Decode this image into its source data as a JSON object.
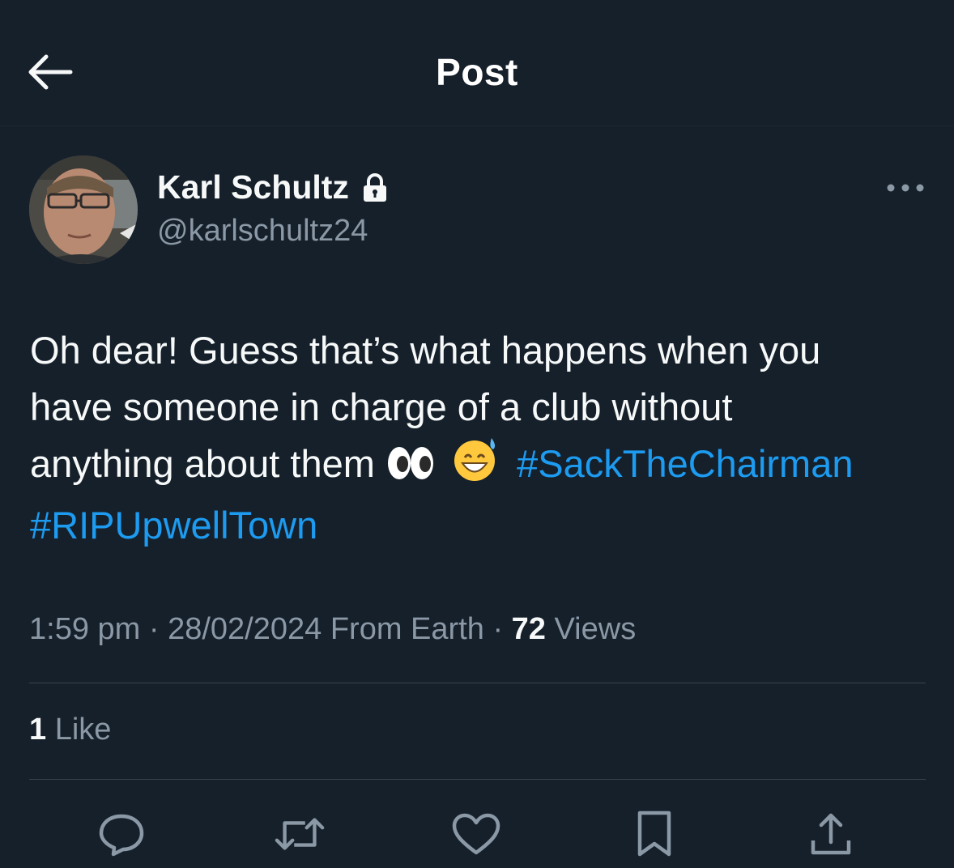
{
  "header": {
    "title": "Post",
    "back_icon": "arrow-left-icon"
  },
  "author": {
    "display_name": "Karl Schultz",
    "handle": "@karlschultz24",
    "protected_icon": "lock-icon"
  },
  "post": {
    "text_line_1": "Oh dear! Guess that’s what happens when you",
    "text_line_2": "have someone in charge of a club without",
    "text_line_3_prefix": "anything about them",
    "emojis": [
      "👀",
      "😅"
    ],
    "hashtags": [
      "#SackTheChairman",
      "#RIPUpwellTown"
    ]
  },
  "meta": {
    "time": "1:59 pm",
    "separator": "·",
    "date": "28/02/2024",
    "source": "From Earth",
    "views_count": "72",
    "views_label": "Views"
  },
  "engagement": {
    "likes_count": "1",
    "likes_label": "Like"
  },
  "actions": [
    "reply-icon",
    "repost-icon",
    "like-icon",
    "bookmark-icon",
    "share-icon"
  ],
  "colors": {
    "background": "#15202b",
    "text": "#f7f9f9",
    "secondary_text": "#8b98a5",
    "link": "#1d9bf0",
    "divider": "#38444d"
  }
}
